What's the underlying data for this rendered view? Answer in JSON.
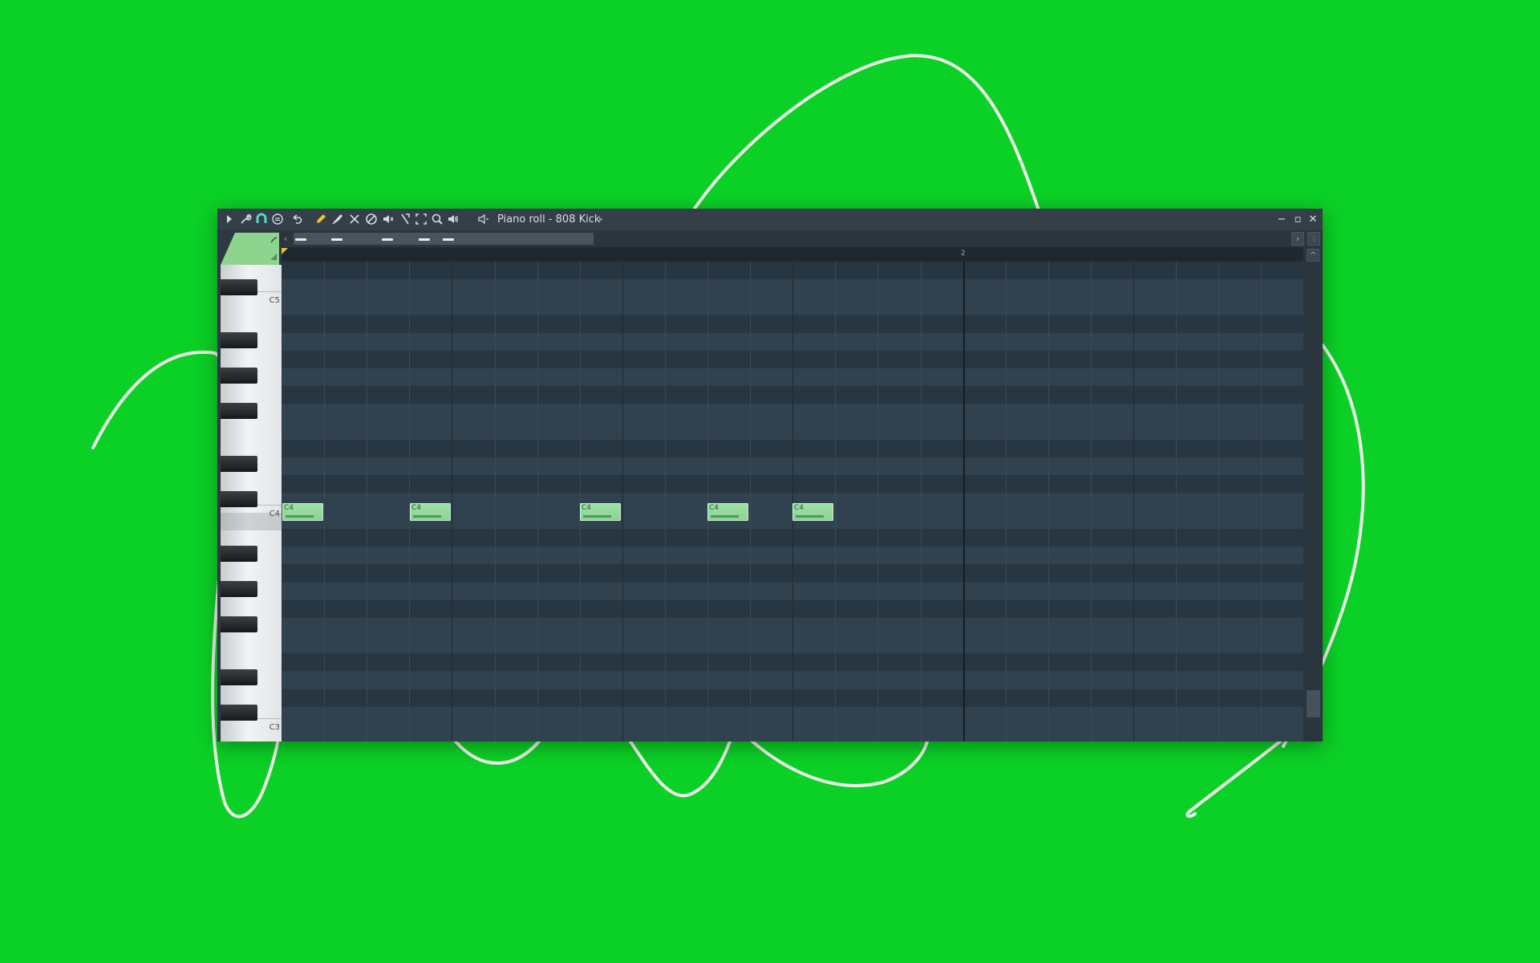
{
  "window": {
    "title": "Piano roll - 808 Kick",
    "title_arrow": "▸",
    "minimize": "−",
    "maximize": "▫",
    "close": "✕"
  },
  "toolbar": {
    "icons": [
      "play-arrow-icon",
      "wrench-icon",
      "magnet-icon",
      "snap-icon",
      "undo-icon",
      "pencil-icon",
      "brush-icon",
      "delete-icon",
      "mute-icon",
      "slice-icon",
      "select-icon",
      "zoom-icon",
      "playback-icon",
      "speaker-icon",
      "speaker-toggle-icon"
    ]
  },
  "ruler": {
    "bar_label": "2"
  },
  "keyboard": {
    "labels": [
      "C5",
      "C4",
      "C3"
    ]
  },
  "notes": [
    {
      "label": "C4",
      "velocity": 0.78
    },
    {
      "label": "C4",
      "velocity": 0.78
    },
    {
      "label": "C4",
      "velocity": 0.78
    },
    {
      "label": "C4",
      "velocity": 0.78
    },
    {
      "label": "C4",
      "velocity": 0.78
    }
  ],
  "colors": {
    "background": "#0bd026",
    "note": "#8cd394",
    "accent": "#e8c43a"
  }
}
